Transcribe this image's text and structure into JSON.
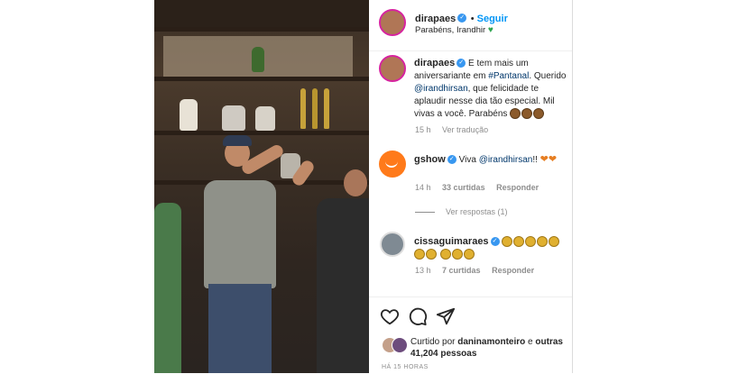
{
  "post": {
    "author": "dirapaes",
    "follow_label": "Seguir",
    "subtitle": "Parabéns, Irandhir",
    "subtitle_emoji": "♥"
  },
  "caption": {
    "author": "dirapaes",
    "text_1": "E tem mais um aniversariante em ",
    "hashtag": "#Pantanal",
    "text_2": ". Querido ",
    "mention": "@irandhirsan",
    "text_3": ", que felicidade te aplaudir nesse dia tão especial. Mil vivas a você. Parabéns",
    "time": "15 h",
    "translate": "Ver tradução"
  },
  "comments": [
    {
      "author": "gshow",
      "text_1": "Viva ",
      "mention": "@irandhirsan",
      "text_2": "!!",
      "time": "14 h",
      "likes": "33 curtidas",
      "reply": "Responder",
      "replies": "Ver respostas (1)"
    },
    {
      "author": "cissaguimaraes",
      "time": "13 h",
      "likes": "7 curtidas",
      "reply": "Responder"
    }
  ],
  "footer": {
    "liked_by_prefix": "Curtido por",
    "liked_by_user": "daninamonteiro",
    "liked_by_mid": "e",
    "liked_by_others": "outras 41,204 pessoas",
    "timestamp": "HÁ 15 HORAS"
  },
  "icons": {
    "like": "heart-icon",
    "comment": "comment-icon",
    "share": "share-icon",
    "verified": "verified-badge-icon"
  },
  "colors": {
    "accent": "#0095f6",
    "verified": "#3897f0",
    "story_ring": "#d6249f"
  }
}
